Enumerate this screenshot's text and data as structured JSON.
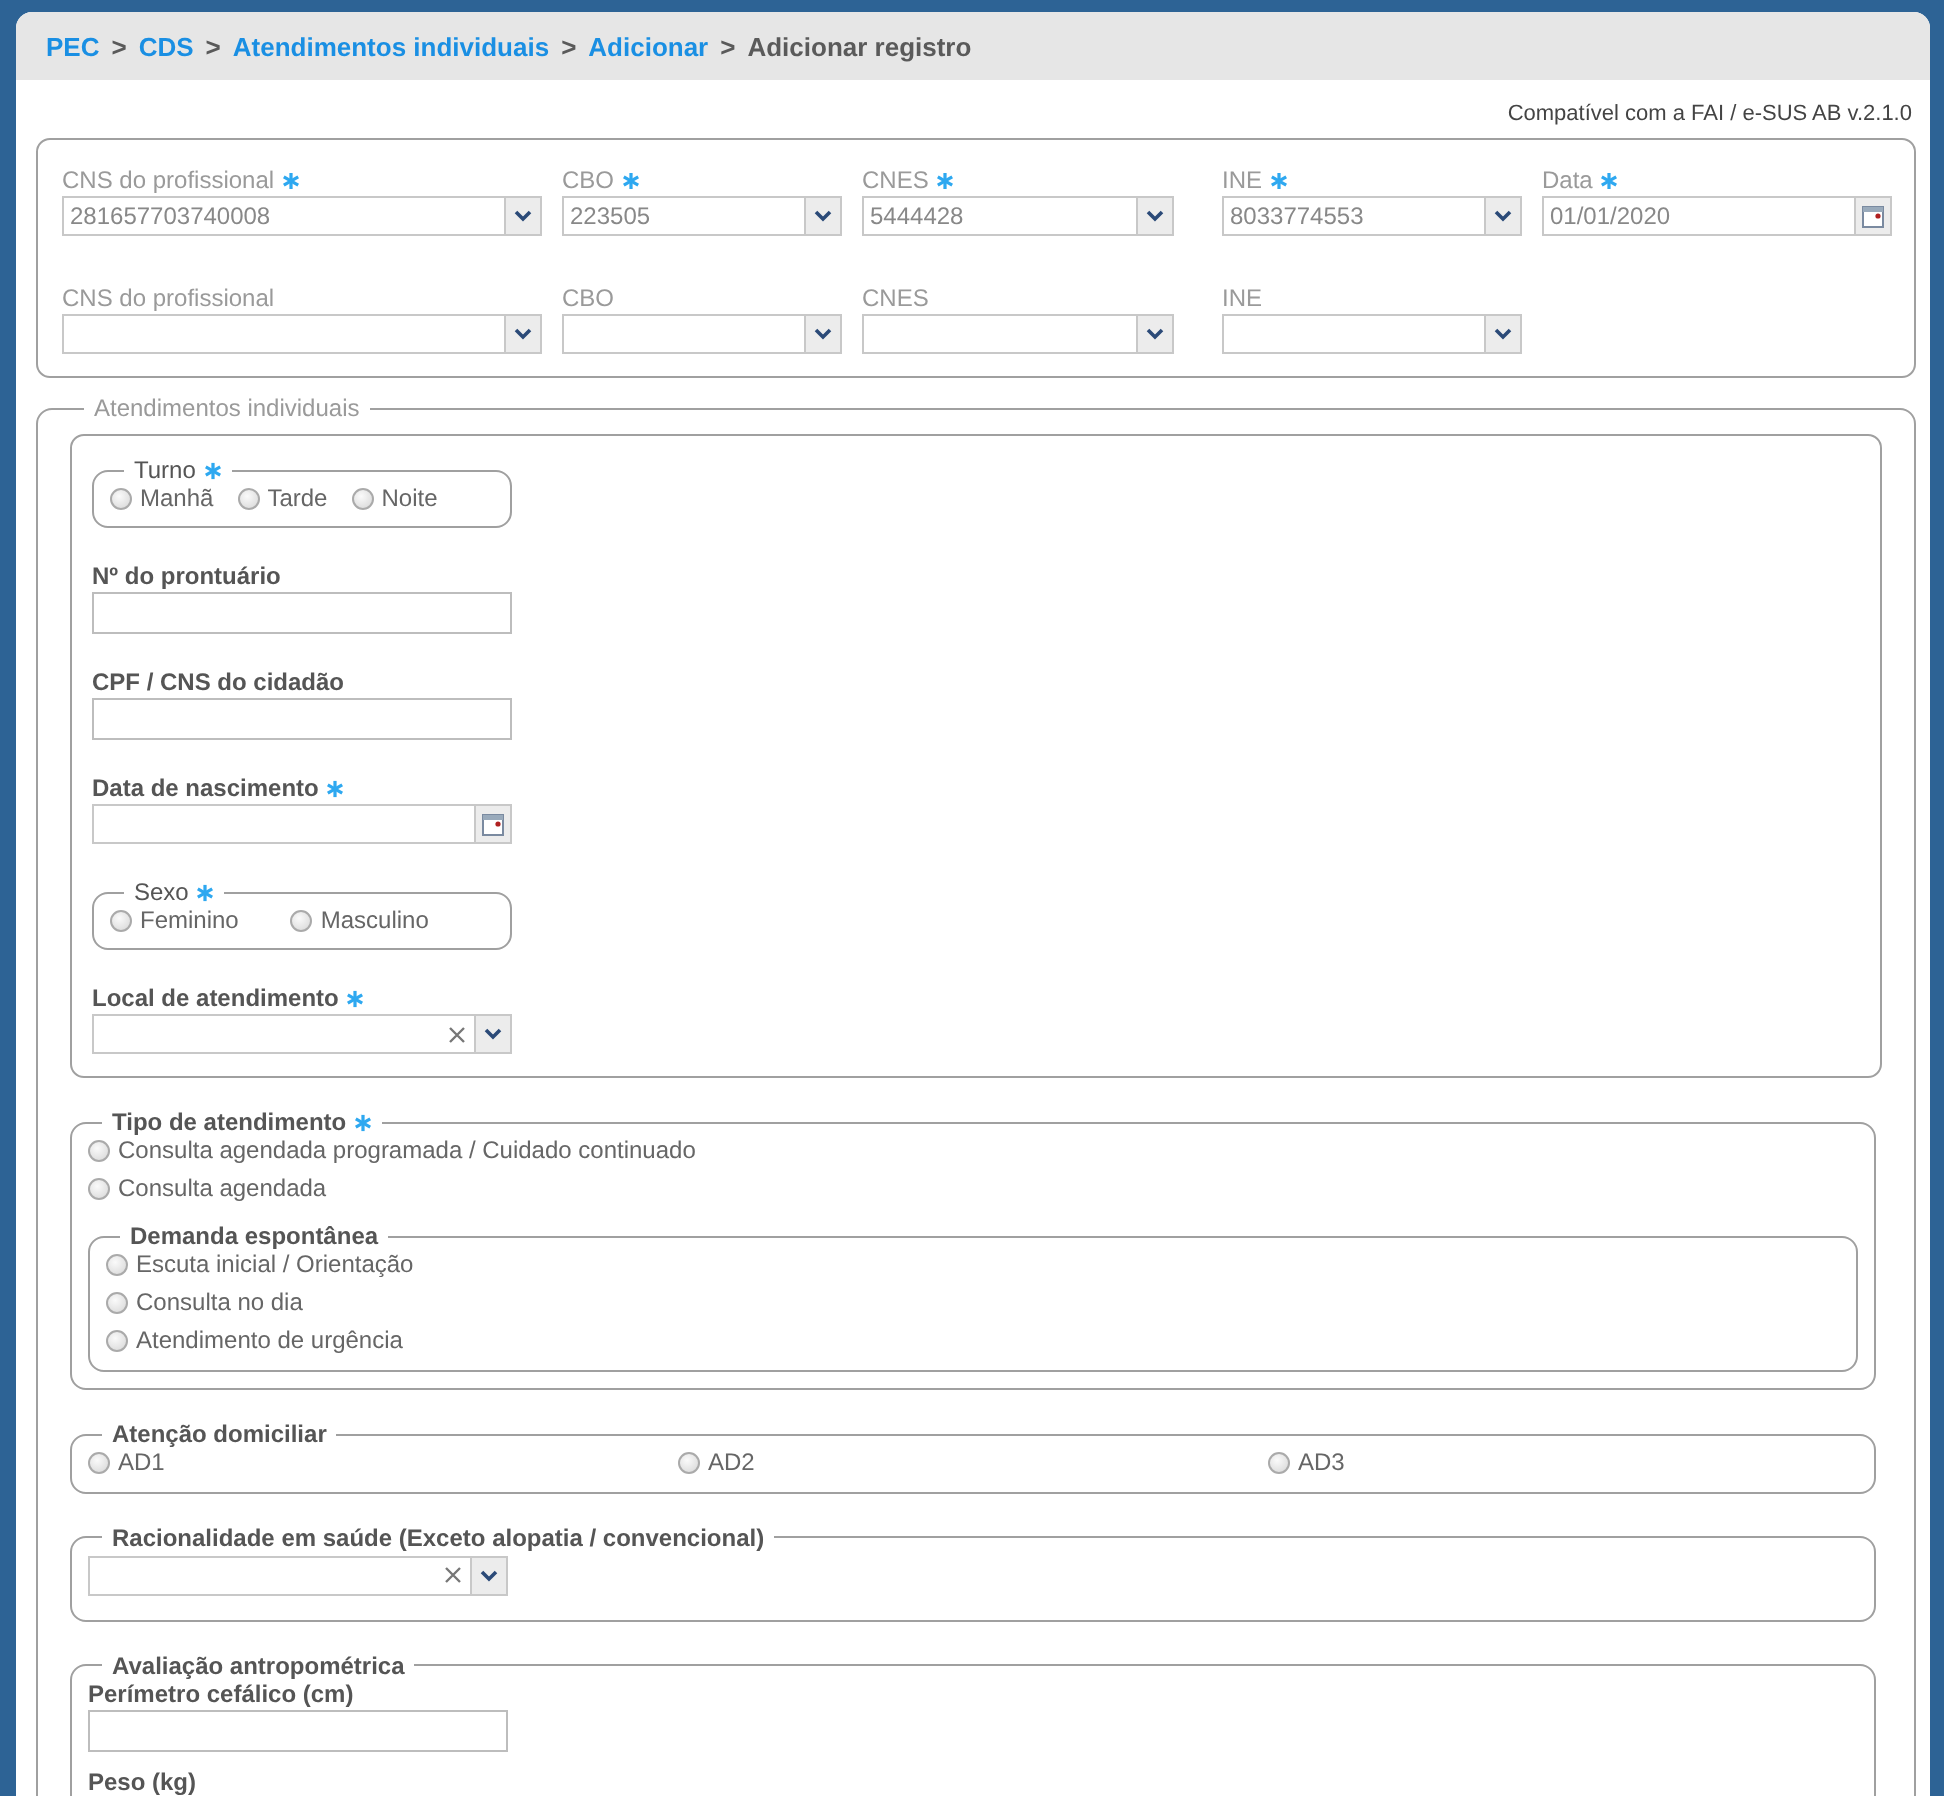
{
  "breadcrumb": [
    {
      "label": "PEC",
      "link": true
    },
    {
      "label": "CDS",
      "link": true
    },
    {
      "label": "Atendimentos individuais",
      "link": true
    },
    {
      "label": "Adicionar",
      "link": true
    },
    {
      "label": "Adicionar registro",
      "link": false
    }
  ],
  "breadcrumb_separator": ">",
  "compat_note": "Compatível com a FAI / e-SUS AB v.2.1.0",
  "professional_rows": [
    [
      {
        "label": "CNS do profissional",
        "required": true,
        "value": "281657703740008",
        "kind": "select"
      },
      {
        "label": "CBO",
        "required": true,
        "value": "223505",
        "kind": "select"
      },
      {
        "label": "CNES",
        "required": true,
        "value": "5444428",
        "kind": "select"
      },
      {
        "label": "INE",
        "required": true,
        "value": "8033774553",
        "kind": "select"
      },
      {
        "label": "Data",
        "required": true,
        "value": "01/01/2020",
        "kind": "date"
      }
    ],
    [
      {
        "label": "CNS do profissional",
        "required": false,
        "kind": "select"
      },
      {
        "label": "CBO",
        "required": false,
        "kind": "select"
      },
      {
        "label": "CNES",
        "required": false,
        "kind": "select"
      },
      {
        "label": "INE",
        "required": false,
        "kind": "select"
      }
    ]
  ],
  "section": {
    "title": "Atendimentos individuais",
    "patient": [
      {
        "kind": "radios",
        "label": "Turno",
        "required": true,
        "options": [
          {
            "label": "Manhã",
            "selected": false
          },
          {
            "label": "Tarde",
            "selected": false
          },
          {
            "label": "Noite",
            "selected": false
          }
        ]
      },
      {
        "kind": "text",
        "label": "Nº do prontuário",
        "required": false
      },
      {
        "kind": "text",
        "label": "CPF / CNS do cidadão",
        "required": false
      },
      {
        "kind": "date",
        "label": "Data de nascimento",
        "required": true
      },
      {
        "kind": "radios",
        "label": "Sexo",
        "required": true,
        "options": [
          {
            "label": "Feminino",
            "selected": false
          },
          {
            "label": "Masculino",
            "selected": false
          }
        ]
      },
      {
        "kind": "combo",
        "label": "Local de atendimento",
        "required": true
      }
    ],
    "tipo": {
      "label": "Tipo de atendimento",
      "required": true,
      "options": [
        {
          "label": "Consulta agendada programada / Cuidado continuado",
          "selected": false
        },
        {
          "label": "Consulta agendada",
          "selected": false
        }
      ],
      "demanda": {
        "label": "Demanda espontânea",
        "options": [
          {
            "label": "Escuta inicial / Orientação",
            "selected": false
          },
          {
            "label": "Consulta no dia",
            "selected": false
          },
          {
            "label": "Atendimento de urgência",
            "selected": false
          }
        ]
      }
    },
    "atencao": {
      "label": "Atenção domiciliar",
      "options": [
        {
          "label": "AD1",
          "selected": false
        },
        {
          "label": "AD2",
          "selected": false
        },
        {
          "label": "AD3",
          "selected": false
        }
      ]
    },
    "racionalidade": {
      "label": "Racionalidade em saúde (Exceto alopatia / convencional)"
    },
    "antropometria": {
      "label": "Avaliação antropométrica",
      "fields": [
        {
          "label": "Perímetro cefálico (cm)"
        },
        {
          "label": "Peso (kg)"
        }
      ]
    }
  }
}
